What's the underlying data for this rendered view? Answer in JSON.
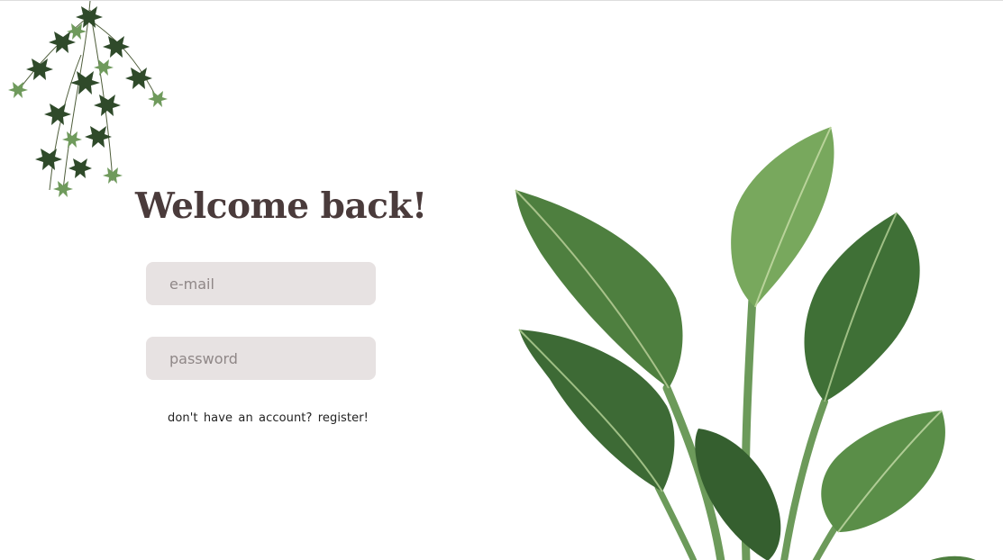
{
  "login": {
    "title": "Welcome back!",
    "email": {
      "value": "",
      "placeholder": "e-mail"
    },
    "password": {
      "value": "",
      "placeholder": "password"
    },
    "register_link": "don't have an account? register!"
  },
  "images": {
    "top_left": "hanging-ivy-plant",
    "bottom_right": "leafy-green-plant"
  },
  "colors": {
    "title": "#4a3b3b",
    "input_background": "#e7e2e2",
    "placeholder": "#8f8787",
    "link": "#222222",
    "leaf_dark": "#3d6a38",
    "leaf_light": "#6f9a5c"
  }
}
